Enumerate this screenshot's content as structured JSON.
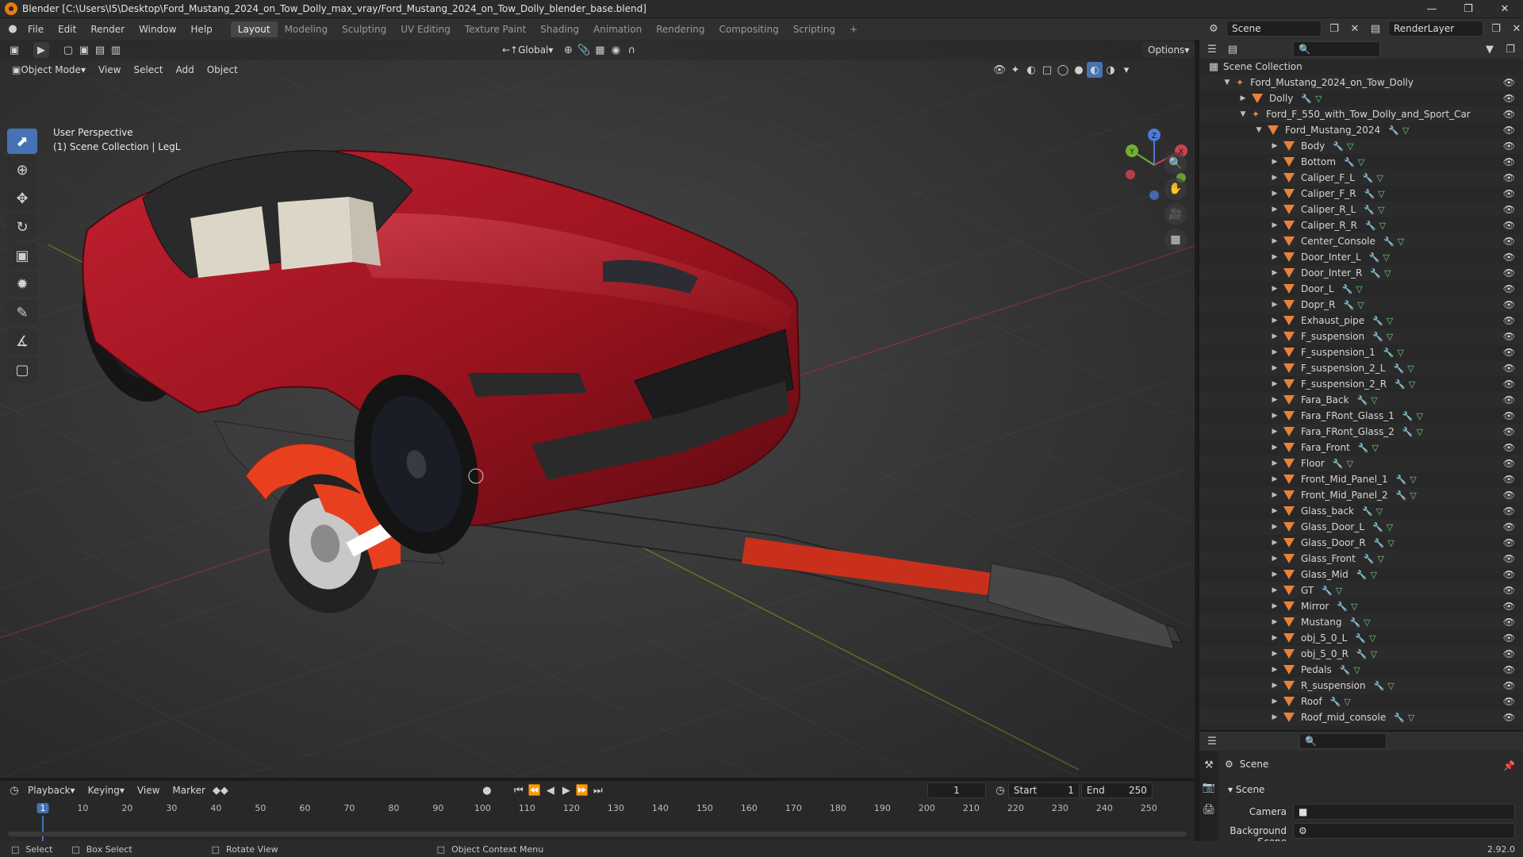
{
  "title": "Blender [C:\\Users\\I5\\Desktop\\Ford_Mustang_2024_on_Tow_Dolly_max_vray/Ford_Mustang_2024_on_Tow_Dolly_blender_base.blend]",
  "menu": [
    "File",
    "Edit",
    "Render",
    "Window",
    "Help"
  ],
  "workspaces": [
    "Layout",
    "Modeling",
    "Sculpting",
    "UV Editing",
    "Texture Paint",
    "Shading",
    "Animation",
    "Rendering",
    "Compositing",
    "Scripting"
  ],
  "active_workspace": "Layout",
  "scene_name": "Scene",
  "render_layer": "RenderLayer",
  "viewport": {
    "mode": "Object Mode",
    "menus": [
      "View",
      "Select",
      "Add",
      "Object"
    ],
    "transform": "Global",
    "options": "Options",
    "perspective": "User Perspective",
    "context": "(1) Scene Collection | LegL"
  },
  "gizmo": {
    "x": "X",
    "y": "Y",
    "z": "Z"
  },
  "outliner": {
    "root": "Scene Collection",
    "items": [
      {
        "label": "Ford_Mustang_2024_on_Tow_Dolly",
        "depth": 1,
        "type": "empty",
        "open": true
      },
      {
        "label": "Dolly",
        "depth": 2,
        "type": "mesh",
        "open": false
      },
      {
        "label": "Ford_F_550_with_Tow_Dolly_and_Sport_Car",
        "depth": 2,
        "type": "empty",
        "open": true
      },
      {
        "label": "Ford_Mustang_2024",
        "depth": 3,
        "type": "mesh",
        "open": true
      },
      {
        "label": "Body",
        "depth": 4,
        "type": "mesh"
      },
      {
        "label": "Bottom",
        "depth": 4,
        "type": "mesh"
      },
      {
        "label": "Caliper_F_L",
        "depth": 4,
        "type": "mesh"
      },
      {
        "label": "Caliper_F_R",
        "depth": 4,
        "type": "mesh"
      },
      {
        "label": "Caliper_R_L",
        "depth": 4,
        "type": "mesh"
      },
      {
        "label": "Caliper_R_R",
        "depth": 4,
        "type": "mesh"
      },
      {
        "label": "Center_Console",
        "depth": 4,
        "type": "mesh"
      },
      {
        "label": "Door_Inter_L",
        "depth": 4,
        "type": "mesh"
      },
      {
        "label": "Door_Inter_R",
        "depth": 4,
        "type": "mesh"
      },
      {
        "label": "Door_L",
        "depth": 4,
        "type": "mesh"
      },
      {
        "label": "Dopr_R",
        "depth": 4,
        "type": "mesh"
      },
      {
        "label": "Exhaust_pipe",
        "depth": 4,
        "type": "mesh"
      },
      {
        "label": "F_suspension",
        "depth": 4,
        "type": "mesh"
      },
      {
        "label": "F_suspension_1",
        "depth": 4,
        "type": "mesh"
      },
      {
        "label": "F_suspension_2_L",
        "depth": 4,
        "type": "mesh"
      },
      {
        "label": "F_suspension_2_R",
        "depth": 4,
        "type": "mesh"
      },
      {
        "label": "Fara_Back",
        "depth": 4,
        "type": "mesh"
      },
      {
        "label": "Fara_FRont_Glass_1",
        "depth": 4,
        "type": "mesh"
      },
      {
        "label": "Fara_FRont_Glass_2",
        "depth": 4,
        "type": "mesh"
      },
      {
        "label": "Fara_Front",
        "depth": 4,
        "type": "mesh"
      },
      {
        "label": "Floor",
        "depth": 4,
        "type": "mesh"
      },
      {
        "label": "Front_Mid_Panel_1",
        "depth": 4,
        "type": "mesh"
      },
      {
        "label": "Front_Mid_Panel_2",
        "depth": 4,
        "type": "mesh"
      },
      {
        "label": "Glass_back",
        "depth": 4,
        "type": "mesh"
      },
      {
        "label": "Glass_Door_L",
        "depth": 4,
        "type": "mesh"
      },
      {
        "label": "Glass_Door_R",
        "depth": 4,
        "type": "mesh"
      },
      {
        "label": "Glass_Front",
        "depth": 4,
        "type": "mesh"
      },
      {
        "label": "Glass_Mid",
        "depth": 4,
        "type": "mesh"
      },
      {
        "label": "GT",
        "depth": 4,
        "type": "mesh"
      },
      {
        "label": "Mirror",
        "depth": 4,
        "type": "mesh"
      },
      {
        "label": "Mustang",
        "depth": 4,
        "type": "mesh"
      },
      {
        "label": "obj_5_0_L",
        "depth": 4,
        "type": "mesh"
      },
      {
        "label": "obj_5_0_R",
        "depth": 4,
        "type": "mesh"
      },
      {
        "label": "Pedals",
        "depth": 4,
        "type": "mesh"
      },
      {
        "label": "R_suspension",
        "depth": 4,
        "type": "mesh"
      },
      {
        "label": "Roof",
        "depth": 4,
        "type": "mesh"
      },
      {
        "label": "Roof_mid_console",
        "depth": 4,
        "type": "mesh"
      }
    ]
  },
  "properties": {
    "header": "Scene",
    "section": "Scene",
    "camera_label": "Camera",
    "bg_scene_label": "Background Scene"
  },
  "timeline": {
    "menus": [
      "Playback",
      "Keying",
      "View",
      "Marker"
    ],
    "current_frame": "1",
    "start_label": "Start",
    "start": "1",
    "end_label": "End",
    "end": "250",
    "ticks": [
      "1",
      "10",
      "20",
      "30",
      "40",
      "50",
      "60",
      "70",
      "80",
      "90",
      "100",
      "110",
      "120",
      "130",
      "140",
      "150",
      "160",
      "170",
      "180",
      "190",
      "200",
      "210",
      "220",
      "230",
      "240",
      "250"
    ]
  },
  "status": {
    "select": "Select",
    "box_select": "Box Select",
    "rotate_view": "Rotate View",
    "context_menu": "Object Context Menu",
    "version": "2.92.0"
  },
  "colors": {
    "accent": "#4772b3",
    "car_red": "#9e1420",
    "dolly_orange": "#e8401f"
  }
}
